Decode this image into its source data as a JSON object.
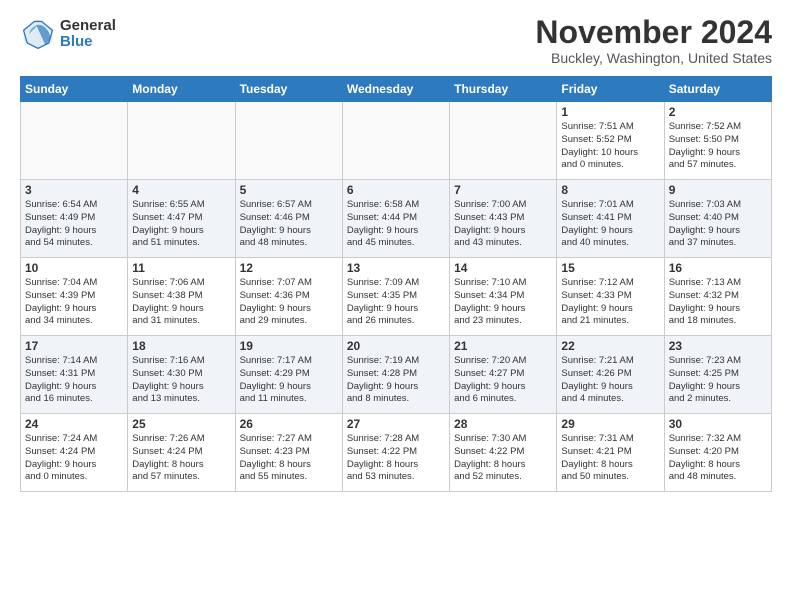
{
  "logo": {
    "general": "General",
    "blue": "Blue"
  },
  "title": "November 2024",
  "location": "Buckley, Washington, United States",
  "days_header": [
    "Sunday",
    "Monday",
    "Tuesday",
    "Wednesday",
    "Thursday",
    "Friday",
    "Saturday"
  ],
  "weeks": [
    [
      {
        "day": "",
        "info": ""
      },
      {
        "day": "",
        "info": ""
      },
      {
        "day": "",
        "info": ""
      },
      {
        "day": "",
        "info": ""
      },
      {
        "day": "",
        "info": ""
      },
      {
        "day": "1",
        "info": "Sunrise: 7:51 AM\nSunset: 5:52 PM\nDaylight: 10 hours\nand 0 minutes."
      },
      {
        "day": "2",
        "info": "Sunrise: 7:52 AM\nSunset: 5:50 PM\nDaylight: 9 hours\nand 57 minutes."
      }
    ],
    [
      {
        "day": "3",
        "info": "Sunrise: 6:54 AM\nSunset: 4:49 PM\nDaylight: 9 hours\nand 54 minutes."
      },
      {
        "day": "4",
        "info": "Sunrise: 6:55 AM\nSunset: 4:47 PM\nDaylight: 9 hours\nand 51 minutes."
      },
      {
        "day": "5",
        "info": "Sunrise: 6:57 AM\nSunset: 4:46 PM\nDaylight: 9 hours\nand 48 minutes."
      },
      {
        "day": "6",
        "info": "Sunrise: 6:58 AM\nSunset: 4:44 PM\nDaylight: 9 hours\nand 45 minutes."
      },
      {
        "day": "7",
        "info": "Sunrise: 7:00 AM\nSunset: 4:43 PM\nDaylight: 9 hours\nand 43 minutes."
      },
      {
        "day": "8",
        "info": "Sunrise: 7:01 AM\nSunset: 4:41 PM\nDaylight: 9 hours\nand 40 minutes."
      },
      {
        "day": "9",
        "info": "Sunrise: 7:03 AM\nSunset: 4:40 PM\nDaylight: 9 hours\nand 37 minutes."
      }
    ],
    [
      {
        "day": "10",
        "info": "Sunrise: 7:04 AM\nSunset: 4:39 PM\nDaylight: 9 hours\nand 34 minutes."
      },
      {
        "day": "11",
        "info": "Sunrise: 7:06 AM\nSunset: 4:38 PM\nDaylight: 9 hours\nand 31 minutes."
      },
      {
        "day": "12",
        "info": "Sunrise: 7:07 AM\nSunset: 4:36 PM\nDaylight: 9 hours\nand 29 minutes."
      },
      {
        "day": "13",
        "info": "Sunrise: 7:09 AM\nSunset: 4:35 PM\nDaylight: 9 hours\nand 26 minutes."
      },
      {
        "day": "14",
        "info": "Sunrise: 7:10 AM\nSunset: 4:34 PM\nDaylight: 9 hours\nand 23 minutes."
      },
      {
        "day": "15",
        "info": "Sunrise: 7:12 AM\nSunset: 4:33 PM\nDaylight: 9 hours\nand 21 minutes."
      },
      {
        "day": "16",
        "info": "Sunrise: 7:13 AM\nSunset: 4:32 PM\nDaylight: 9 hours\nand 18 minutes."
      }
    ],
    [
      {
        "day": "17",
        "info": "Sunrise: 7:14 AM\nSunset: 4:31 PM\nDaylight: 9 hours\nand 16 minutes."
      },
      {
        "day": "18",
        "info": "Sunrise: 7:16 AM\nSunset: 4:30 PM\nDaylight: 9 hours\nand 13 minutes."
      },
      {
        "day": "19",
        "info": "Sunrise: 7:17 AM\nSunset: 4:29 PM\nDaylight: 9 hours\nand 11 minutes."
      },
      {
        "day": "20",
        "info": "Sunrise: 7:19 AM\nSunset: 4:28 PM\nDaylight: 9 hours\nand 8 minutes."
      },
      {
        "day": "21",
        "info": "Sunrise: 7:20 AM\nSunset: 4:27 PM\nDaylight: 9 hours\nand 6 minutes."
      },
      {
        "day": "22",
        "info": "Sunrise: 7:21 AM\nSunset: 4:26 PM\nDaylight: 9 hours\nand 4 minutes."
      },
      {
        "day": "23",
        "info": "Sunrise: 7:23 AM\nSunset: 4:25 PM\nDaylight: 9 hours\nand 2 minutes."
      }
    ],
    [
      {
        "day": "24",
        "info": "Sunrise: 7:24 AM\nSunset: 4:24 PM\nDaylight: 9 hours\nand 0 minutes."
      },
      {
        "day": "25",
        "info": "Sunrise: 7:26 AM\nSunset: 4:24 PM\nDaylight: 8 hours\nand 57 minutes."
      },
      {
        "day": "26",
        "info": "Sunrise: 7:27 AM\nSunset: 4:23 PM\nDaylight: 8 hours\nand 55 minutes."
      },
      {
        "day": "27",
        "info": "Sunrise: 7:28 AM\nSunset: 4:22 PM\nDaylight: 8 hours\nand 53 minutes."
      },
      {
        "day": "28",
        "info": "Sunrise: 7:30 AM\nSunset: 4:22 PM\nDaylight: 8 hours\nand 52 minutes."
      },
      {
        "day": "29",
        "info": "Sunrise: 7:31 AM\nSunset: 4:21 PM\nDaylight: 8 hours\nand 50 minutes."
      },
      {
        "day": "30",
        "info": "Sunrise: 7:32 AM\nSunset: 4:20 PM\nDaylight: 8 hours\nand 48 minutes."
      }
    ]
  ]
}
